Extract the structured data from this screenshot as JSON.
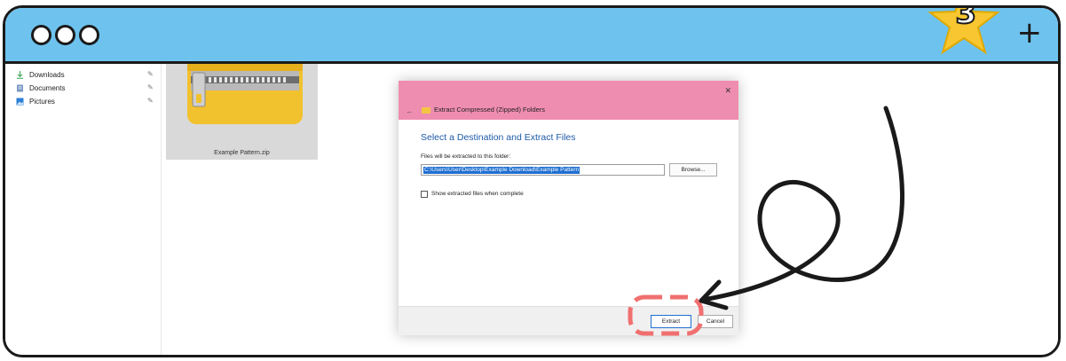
{
  "window": {
    "traffic_lights": [
      "dot-1",
      "dot-2",
      "dot-3"
    ],
    "new_tab_label": "+",
    "step_badge": "3",
    "titlebar_color": "#6ec3ee"
  },
  "sidebar": {
    "items": [
      {
        "label": "Downloads",
        "icon": "download-icon"
      },
      {
        "label": "Documents",
        "icon": "document-icon"
      },
      {
        "label": "Pictures",
        "icon": "pictures-icon"
      }
    ],
    "pin_icon": "pin-icon"
  },
  "file": {
    "name": "Example Pattern.zip",
    "icon": "zip-folder-icon"
  },
  "dialog": {
    "title": "Extract Compressed (Zipped) Folders",
    "heading": "Select a Destination and Extract Files",
    "path_label": "Files will be extracted to this folder:",
    "path_value": "C:\\Users\\User\\Desktop\\Example Download\\Example Pattern",
    "browse_label": "Browse...",
    "checkbox_label": "Show extracted files when complete",
    "checkbox_checked": false,
    "extract_label": "Extract",
    "cancel_label": "Cancel",
    "header_color": "#ef8db0",
    "heading_color": "#1e5aa8"
  },
  "annotations": {
    "highlight_color": "#f07070",
    "arrow_color": "#1a1a1a"
  }
}
